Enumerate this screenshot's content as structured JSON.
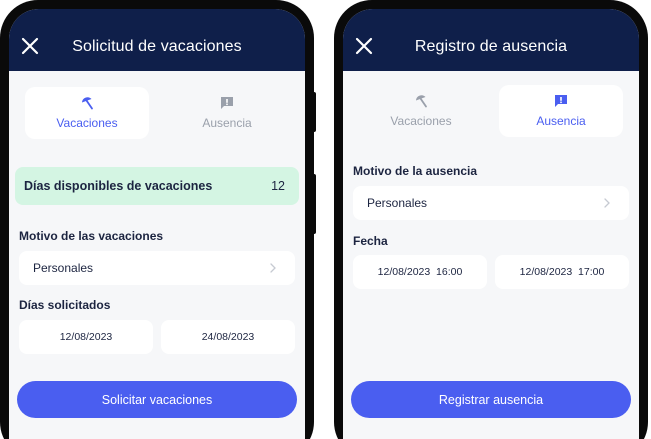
{
  "colors": {
    "header_bg": "#0f1f4a",
    "accent": "#4a5ef0",
    "banner_bg": "#d4f5e3",
    "screen_bg": "#f6f7f9",
    "inactive_text": "#9aa0ab"
  },
  "vacation_screen": {
    "title": "Solicitud de vacaciones",
    "close_icon": "close-icon",
    "tabs": [
      {
        "label": "Vacaciones",
        "icon": "umbrella-icon",
        "active": true
      },
      {
        "label": "Ausencia",
        "icon": "alert-message-icon",
        "active": false
      }
    ],
    "available": {
      "label": "Días disponibles de vacaciones",
      "count": "12"
    },
    "reason_label": "Motivo de las vacaciones",
    "reason_value": "Personales",
    "days_label": "Días solicitados",
    "start_date": "12/08/2023",
    "end_date": "24/08/2023",
    "submit_label": "Solicitar vacaciones"
  },
  "absence_screen": {
    "title": "Registro de ausencia",
    "close_icon": "close-icon",
    "tabs": [
      {
        "label": "Vacaciones",
        "icon": "umbrella-icon",
        "active": false
      },
      {
        "label": "Ausencia",
        "icon": "alert-message-icon",
        "active": true
      }
    ],
    "reason_label": "Motivo de la ausencia",
    "reason_value": "Personales",
    "date_label": "Fecha",
    "start_datetime": "12/08/2023  16:00",
    "end_datetime": "12/08/2023  17:00",
    "submit_label": "Registrar ausencia"
  }
}
